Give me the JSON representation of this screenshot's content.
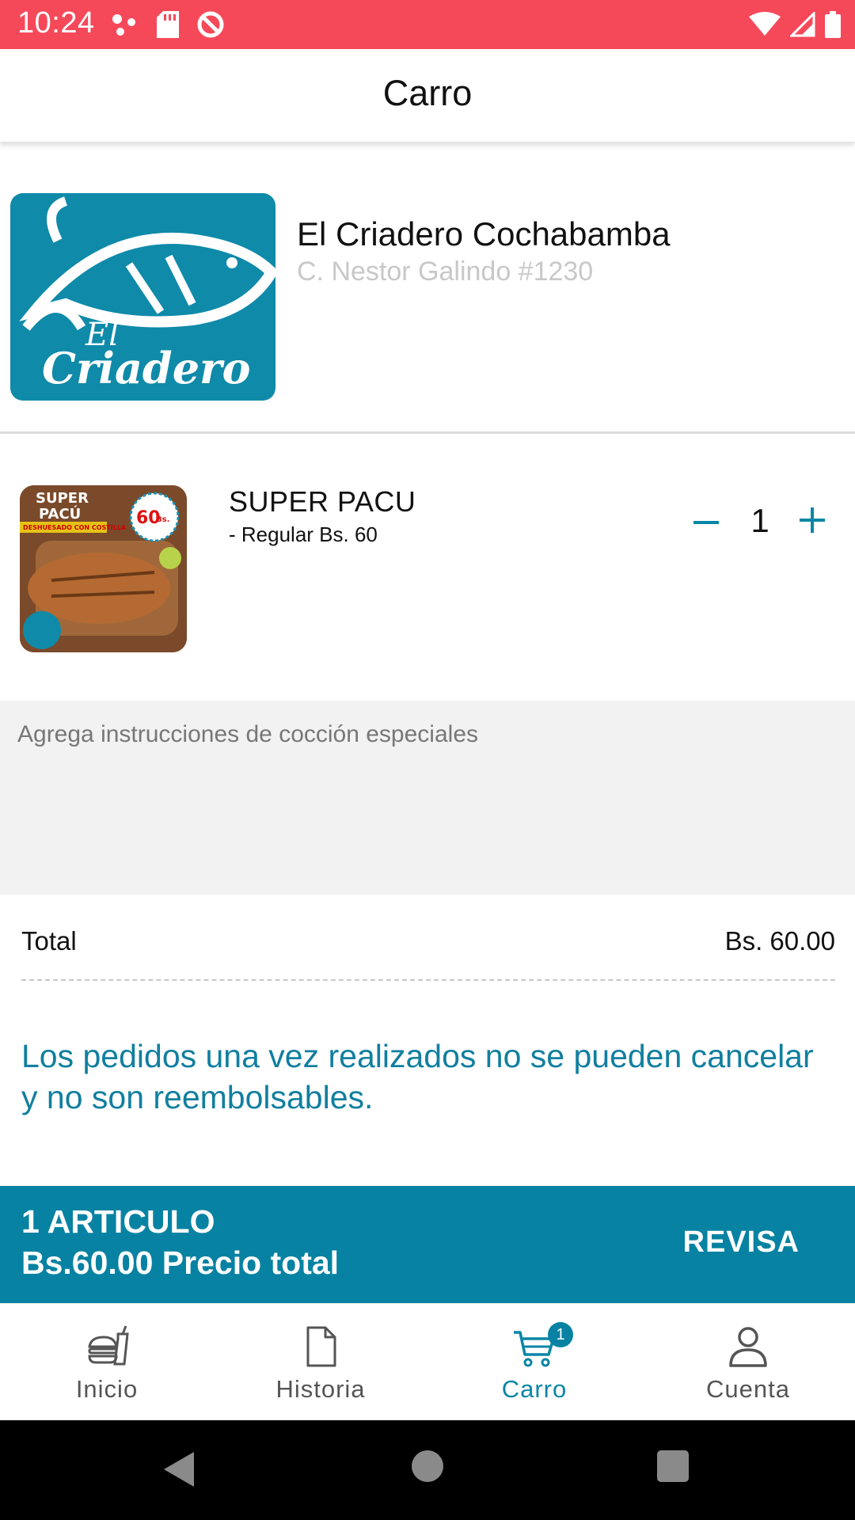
{
  "status_bar": {
    "time": "10:24",
    "left_icons": [
      "dots-icon",
      "sd-card-icon",
      "no-sync-icon"
    ],
    "right_icons": [
      "wifi-icon",
      "cell-signal-icon",
      "battery-icon"
    ]
  },
  "app_bar": {
    "title": "Carro"
  },
  "restaurant": {
    "name": "El Criadero Cochabamba",
    "address": "C. Nestor Galindo #1230",
    "logo": {
      "line1": "El",
      "line2": "Criadero",
      "bg_color": "#0f8aa9"
    }
  },
  "cart_item": {
    "name": "SUPER PACU",
    "variant": "- Regular Bs. 60",
    "quantity": "1",
    "thumb": {
      "title_line1": "SUPER",
      "title_line2": "PACÚ",
      "ribbon": "DESHUESADO CON COSTILLA",
      "price_tag": "60",
      "price_unit": "Bs."
    }
  },
  "instructions": {
    "placeholder": "Agrega instrucciones de cocción especiales"
  },
  "totals": {
    "label": "Total",
    "value": "Bs. 60.00"
  },
  "notice": "Los pedidos una vez realizados no se pueden cancelar y no son reembolsables.",
  "checkout": {
    "count_text": "1 ARTICULO",
    "price_text": "Bs.60.00 Precio total",
    "action": "REVISA",
    "bg_color": "#0782a2"
  },
  "bottom_nav": {
    "items": [
      {
        "label": "Inicio",
        "icon": "food-icon"
      },
      {
        "label": "Historia",
        "icon": "document-icon"
      },
      {
        "label": "Carro",
        "icon": "cart-icon",
        "active": true,
        "badge": "1"
      },
      {
        "label": "Cuenta",
        "icon": "user-icon"
      }
    ]
  },
  "colors": {
    "status_bar": "#f5495a",
    "accent": "#0a86a6"
  }
}
